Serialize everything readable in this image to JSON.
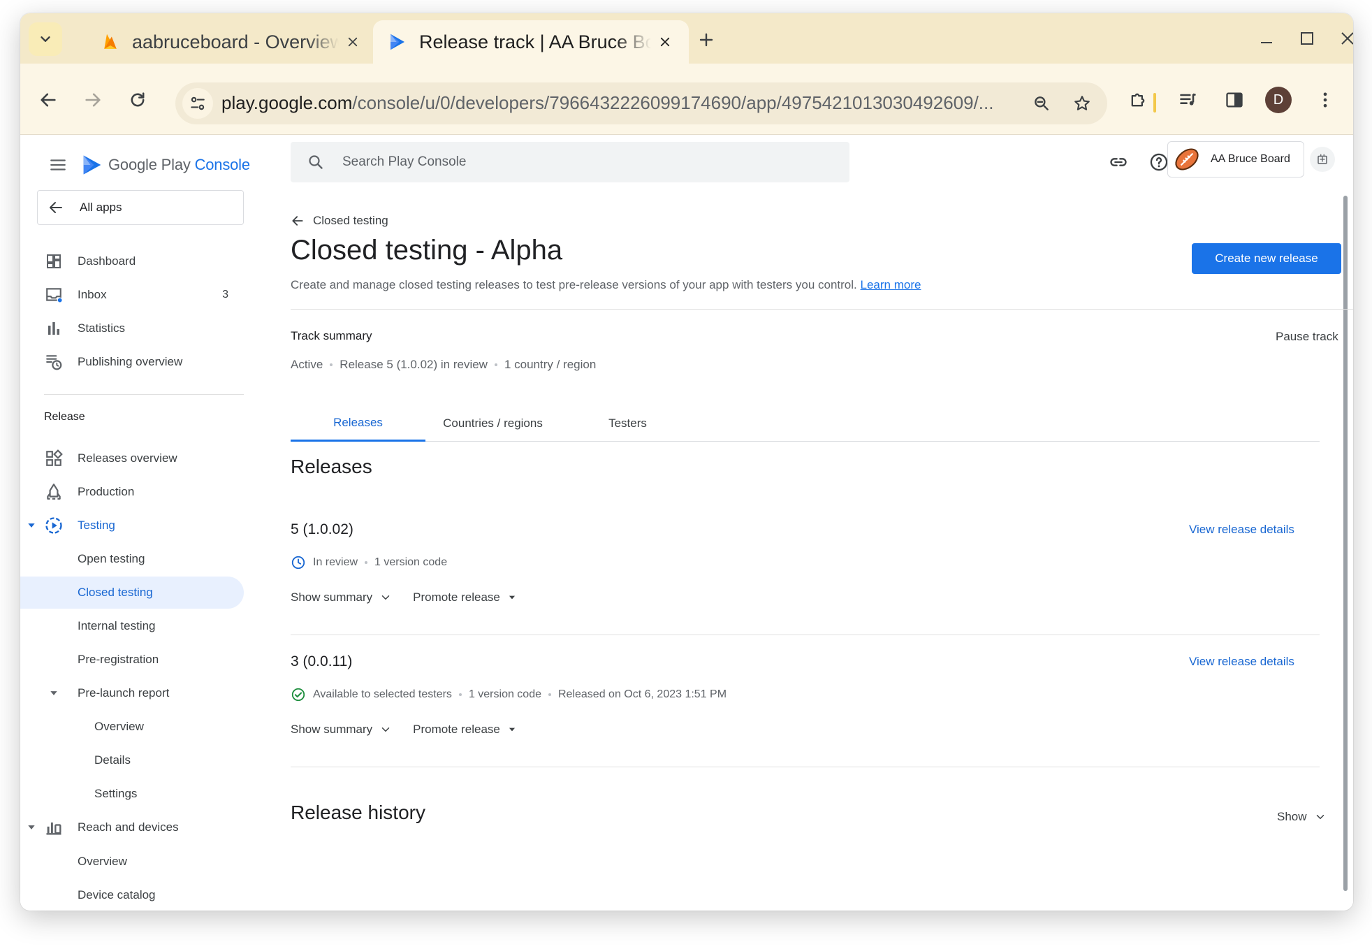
{
  "browser": {
    "tabs": [
      {
        "title": "aabruceboard - Overview",
        "active": false
      },
      {
        "title": "Release track | AA Bruce Board",
        "active": true
      }
    ],
    "url_host": "play.google.com",
    "url_path": "/console/u/0/developers/7966432226099174690/app/4975421013030492609/...",
    "profile_initial": "D"
  },
  "header": {
    "brand_google_play": "Google Play",
    "brand_console": "Console",
    "search_placeholder": "Search Play Console",
    "account_name": "AA Bruce Board"
  },
  "sidebar": {
    "all_apps": "All apps",
    "top_items": [
      {
        "label": "Dashboard"
      },
      {
        "label": "Inbox",
        "count": "3"
      },
      {
        "label": "Statistics"
      },
      {
        "label": "Publishing overview"
      }
    ],
    "section_release": "Release",
    "release_items": {
      "releases_overview": "Releases overview",
      "production": "Production",
      "testing": "Testing",
      "open_testing": "Open testing",
      "closed_testing": "Closed testing",
      "internal_testing": "Internal testing",
      "pre_registration": "Pre-registration",
      "pre_launch_report": "Pre-launch report",
      "plr_overview": "Overview",
      "plr_details": "Details",
      "plr_settings": "Settings",
      "reach_and_devices": "Reach and devices",
      "rd_overview": "Overview",
      "device_catalog": "Device catalog"
    }
  },
  "main": {
    "back_label": "Closed testing",
    "title": "Closed testing - Alpha",
    "description": "Create and manage closed testing releases to test pre-release versions of your app with testers you control.",
    "learn_more": "Learn more",
    "create_button": "Create new release",
    "track_summary_title": "Track summary",
    "pause_track": "Pause track",
    "track_summary": {
      "status": "Active",
      "release": "Release 5 (1.0.02) in review",
      "countries": "1 country / region"
    },
    "tabs": [
      {
        "label": "Releases",
        "active": true
      },
      {
        "label": "Countries / regions",
        "active": false
      },
      {
        "label": "Testers",
        "active": false
      }
    ],
    "releases_heading": "Releases",
    "releases": [
      {
        "name": "5 (1.0.02)",
        "status": "In review",
        "version_codes": "1 version code",
        "released": "",
        "view_details": "View release details",
        "show_summary": "Show summary",
        "promote": "Promote release"
      },
      {
        "name": "3 (0.0.11)",
        "status": "Available to selected testers",
        "version_codes": "1 version code",
        "released": "Released on Oct 6, 2023 1:51 PM",
        "view_details": "View release details",
        "show_summary": "Show summary",
        "promote": "Promote release"
      }
    ],
    "release_history_heading": "Release history",
    "show_label": "Show"
  },
  "colors": {
    "accent": "#1a73e8",
    "selected_bg": "#e8f0fe",
    "tabstrip_bg": "#f4e9c9",
    "toolbar_bg": "#fcf6e6",
    "success": "#1e8e3e"
  }
}
